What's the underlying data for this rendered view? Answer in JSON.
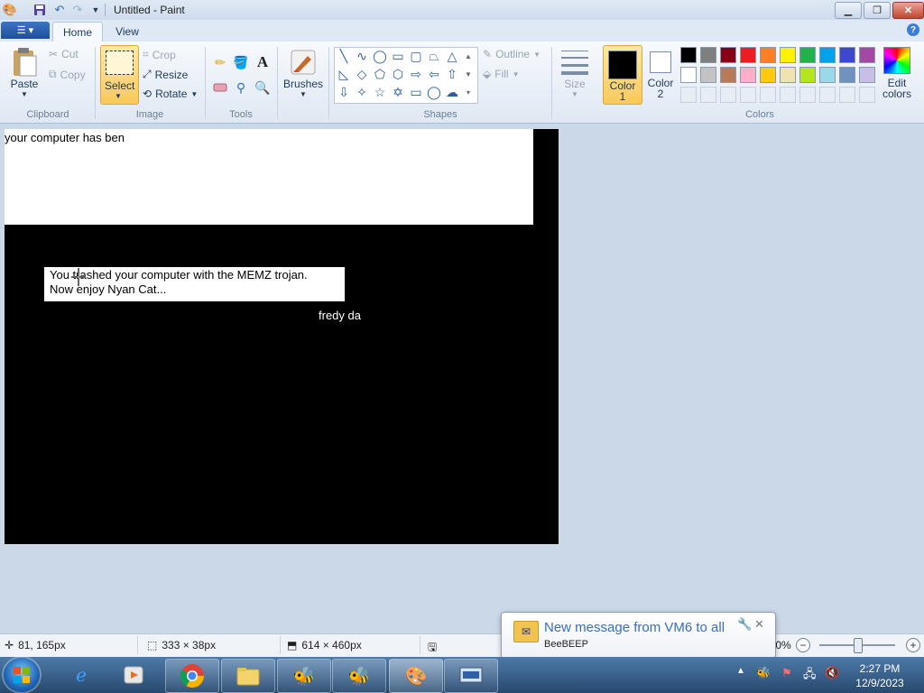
{
  "window": {
    "title": "Untitled - Paint"
  },
  "quick_access": {
    "icons": [
      "paint-app-icon",
      "save-icon",
      "undo-icon",
      "redo-icon",
      "customize-qa-icon"
    ]
  },
  "tabs": {
    "file": "",
    "home": "Home",
    "view": "View"
  },
  "ribbon": {
    "clipboard": {
      "paste": "Paste",
      "cut": "Cut",
      "copy": "Copy",
      "group": "Clipboard"
    },
    "image": {
      "select": "Select",
      "crop": "Crop",
      "resize": "Resize",
      "rotate": "Rotate",
      "group": "Image"
    },
    "tools": {
      "group": "Tools"
    },
    "brushes": {
      "label": "Brushes"
    },
    "shapes": {
      "outline": "Outline",
      "fill": "Fill",
      "group": "Shapes"
    },
    "size": {
      "label": "Size"
    },
    "colors": {
      "color1": "Color",
      "color1_num": "1",
      "color2": "Color",
      "color2_num": "2",
      "edit": "Edit",
      "edit2": "colors",
      "group": "Colors",
      "color1_value": "#000000",
      "color2_value": "#ffffff",
      "palette_row1": [
        "#000000",
        "#7f7f7f",
        "#880015",
        "#ed1c24",
        "#ff7f27",
        "#fff200",
        "#22b14c",
        "#00a2e8",
        "#3f48cc",
        "#a349a4"
      ],
      "palette_row2": [
        "#ffffff",
        "#c3c3c3",
        "#b97a57",
        "#ffaec9",
        "#ffc90e",
        "#efe4b0",
        "#b5e61d",
        "#99d9ea",
        "#7092be",
        "#c8bfe7"
      ]
    }
  },
  "canvas": {
    "text1": "your computer has ben",
    "text2_line1": "You trashed your computer with the MEMZ trojan.",
    "text2_line2": "Now enjoy Nyan Cat...",
    "text3": "fredy da"
  },
  "status": {
    "cursor_pos": "81, 165px",
    "selection_size": "333 × 38px",
    "image_size": "614 × 460px",
    "zoom": "100%",
    "zoom_level": 1.0
  },
  "notification": {
    "title": "New message from VM6 to all",
    "app": "BeeBEEP"
  },
  "taskbar": {
    "time": "2:27 PM",
    "date": "12/9/2023"
  }
}
